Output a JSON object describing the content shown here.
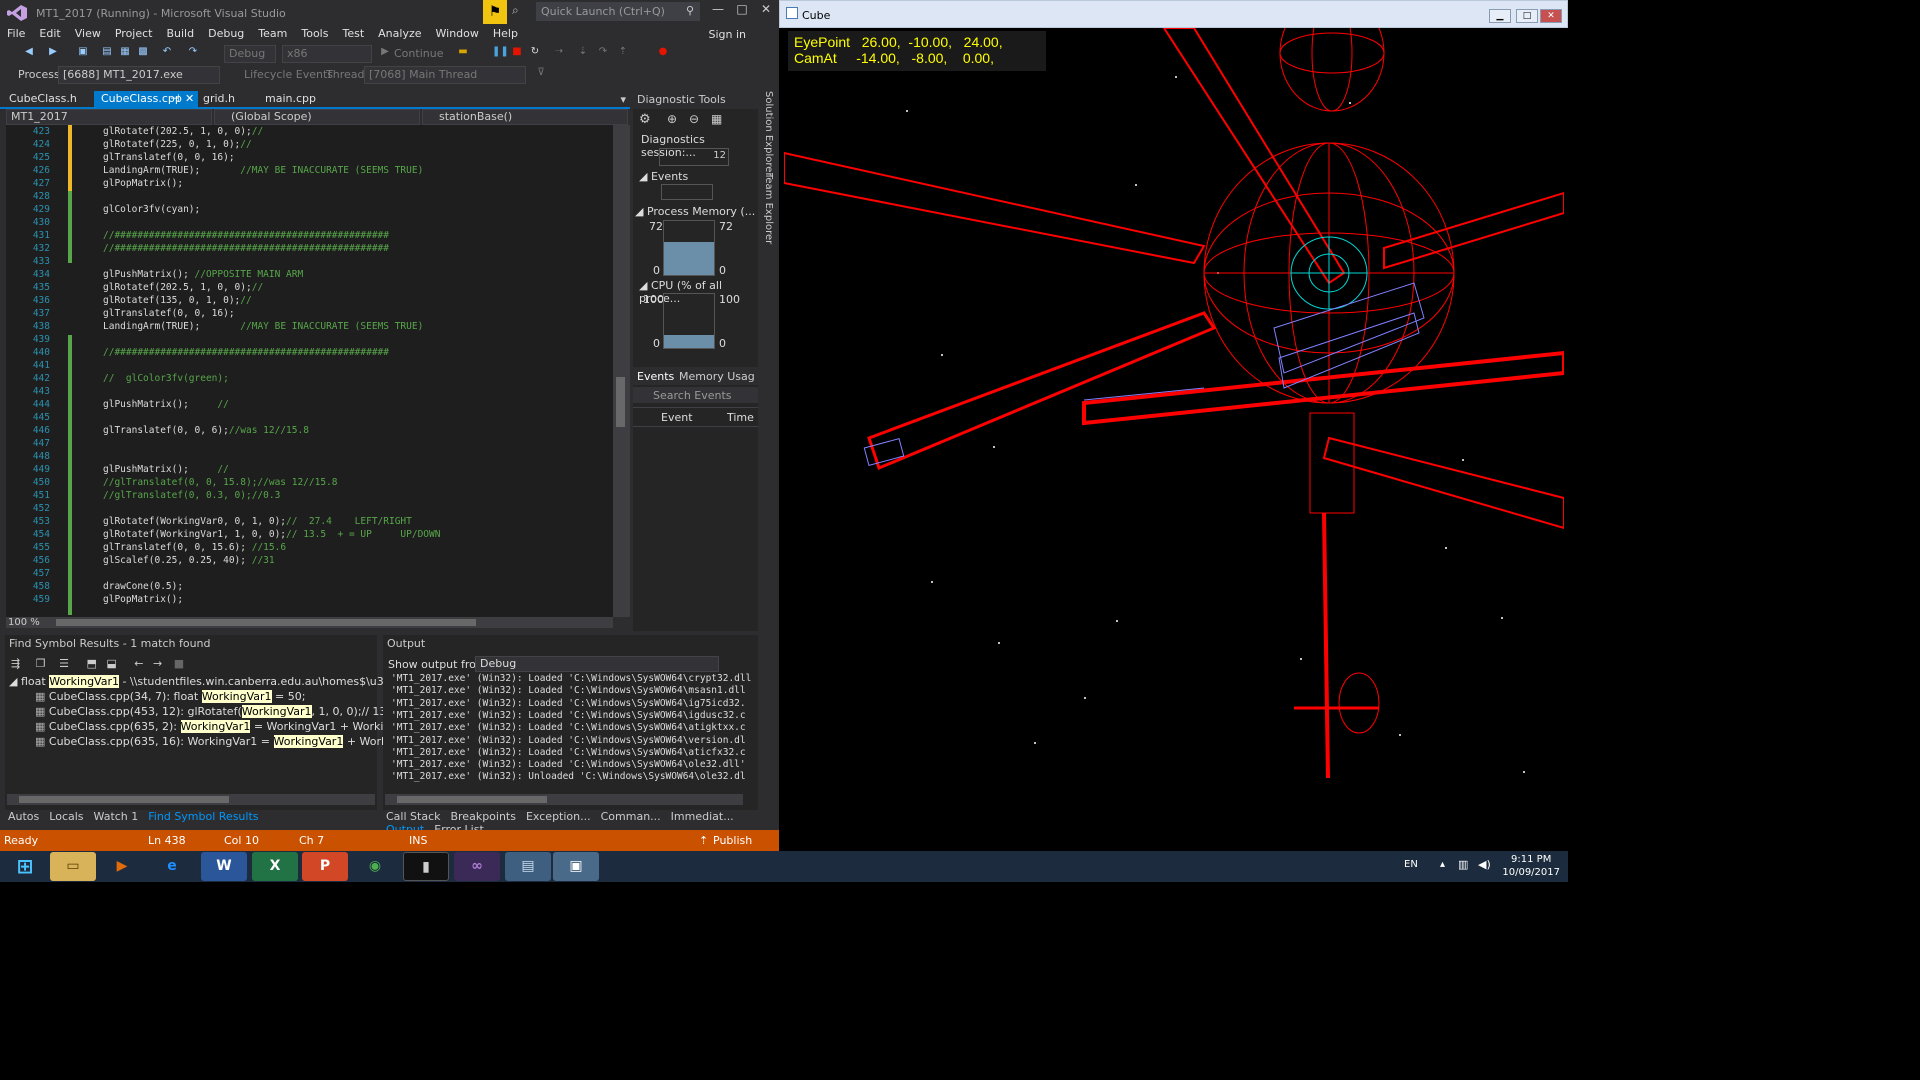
{
  "vs": {
    "title": "MT1_2017 (Running) - Microsoft Visual Studio",
    "quick_launch_placeholder": "Quick Launch (Ctrl+Q)",
    "menu": [
      "File",
      "Edit",
      "View",
      "Project",
      "Build",
      "Debug",
      "Team",
      "Tools",
      "Test",
      "Analyze",
      "Window",
      "Help"
    ],
    "sign_in": "Sign in",
    "config": "Debug",
    "platform": "x86",
    "continue_label": "Continue",
    "process_label": "Process:",
    "process_value": "[6688] MT1_2017.exe",
    "lifecycle_label": "Lifecycle Events",
    "thread_label": "Thread:",
    "thread_value": "[7068] Main Thread",
    "tabs": [
      "CubeClass.h",
      "CubeClass.cpp",
      "grid.h",
      "main.cpp"
    ],
    "active_tab": "CubeClass.cpp",
    "nav_project": "MT1_2017",
    "nav_scope": "(Global Scope)",
    "nav_member": "stationBase()",
    "zoom": "100 %",
    "code": [
      {
        "n": "423",
        "t": "glRotatef(202.5, 1, 0, 0);",
        "c": "//"
      },
      {
        "n": "424",
        "t": "glRotatef(225, 0, 1, 0);",
        "c": "//"
      },
      {
        "n": "425",
        "t": "glTranslatef(0, 0, 16);",
        "c": ""
      },
      {
        "n": "426",
        "t": "LandingArm(TRUE);       ",
        "c": "//MAY BE INACCURATE (SEEMS TRUE)"
      },
      {
        "n": "427",
        "t": "glPopMatrix();",
        "c": ""
      },
      {
        "n": "428",
        "t": "",
        "c": ""
      },
      {
        "n": "429",
        "t": "glColor3fv(cyan);",
        "c": ""
      },
      {
        "n": "430",
        "t": "",
        "c": ""
      },
      {
        "n": "431",
        "t": "",
        "c": "//################################################"
      },
      {
        "n": "432",
        "t": "",
        "c": "//################################################"
      },
      {
        "n": "433",
        "t": "",
        "c": ""
      },
      {
        "n": "434",
        "t": "glPushMatrix(); ",
        "c": "//OPPOSITE MAIN ARM"
      },
      {
        "n": "435",
        "t": "glRotatef(202.5, 1, 0, 0);",
        "c": "//"
      },
      {
        "n": "436",
        "t": "glRotatef(135, 0, 1, 0);",
        "c": "//"
      },
      {
        "n": "437",
        "t": "glTranslatef(0, 0, 16);",
        "c": ""
      },
      {
        "n": "438",
        "t": "LandingArm(TRUE);       ",
        "c": "//MAY BE INACCURATE (SEEMS TRUE)"
      },
      {
        "n": "439",
        "t": "",
        "c": ""
      },
      {
        "n": "440",
        "t": "",
        "c": "//################################################"
      },
      {
        "n": "441",
        "t": "",
        "c": ""
      },
      {
        "n": "442",
        "t": "",
        "c": "//  glColor3fv(green);"
      },
      {
        "n": "443",
        "t": "",
        "c": ""
      },
      {
        "n": "444",
        "t": "glPushMatrix();     ",
        "c": "//"
      },
      {
        "n": "445",
        "t": "",
        "c": ""
      },
      {
        "n": "446",
        "t": "glTranslatef(0, 0, 6);",
        "c": "//was 12//15.8"
      },
      {
        "n": "447",
        "t": "",
        "c": ""
      },
      {
        "n": "448",
        "t": "",
        "c": ""
      },
      {
        "n": "449",
        "t": "glPushMatrix();     ",
        "c": "//"
      },
      {
        "n": "450",
        "t": "",
        "c": "//glTranslatef(0, 0, 15.8);//was 12//15.8"
      },
      {
        "n": "451",
        "t": "",
        "c": "//glTranslatef(0, 0.3, 0);//0.3"
      },
      {
        "n": "452",
        "t": "",
        "c": ""
      },
      {
        "n": "453",
        "t": "glRotatef(WorkingVar0, 0, 1, 0);",
        "c": "//  27.4    LEFT/RIGHT"
      },
      {
        "n": "454",
        "t": "glRotatef(WorkingVar1, 1, 0, 0);",
        "c": "// 13.5  + = UP     UP/DOWN"
      },
      {
        "n": "455",
        "t": "glTranslatef(0, 0, 15.6); ",
        "c": "//15.6"
      },
      {
        "n": "456",
        "t": "glScalef(0.25, 0.25, 40); ",
        "c": "//31"
      },
      {
        "n": "457",
        "t": "",
        "c": ""
      },
      {
        "n": "458",
        "t": "drawCone(0.5);",
        "c": ""
      },
      {
        "n": "459",
        "t": "glPopMatrix();",
        "c": ""
      }
    ],
    "diag": {
      "title": "Diagnostic Tools",
      "session": "Diagnostics session:...",
      "session_val": "12",
      "events": "Events",
      "memory": "Process Memory (...",
      "mem_top": "72",
      "mem_bot": "0",
      "mem_fill": 0.62,
      "cpu": "CPU (% of all proce...",
      "cpu_top": "100",
      "cpu_bot": "0",
      "cpu_fill": 0.25,
      "tab_events": "Events",
      "tab_memory": "Memory Usag",
      "search": "Search Events",
      "col_event": "Event",
      "col_time": "Time"
    },
    "side_tabs": [
      "Solution Explorer",
      "Team Explorer"
    ],
    "find": {
      "title": "Find Symbol Results - 1 match found",
      "root_pre": "float ",
      "root_hl": "WorkingVar1",
      "root_post": " - \\\\studentfiles.win.canberra.edu.au\\homes$\\u3151658\\My",
      "rows": [
        {
          "pre": "CubeClass.cpp(34, 7): float ",
          "hl": "WorkingVar1",
          "post": " = 50;"
        },
        {
          "pre": "CubeClass.cpp(453, 12): glRotatef(",
          "hl": "WorkingVar1",
          "post": ", 1, 0, 0);// 13.5  + = UP  UP/"
        },
        {
          "pre": "CubeClass.cpp(635, 2): ",
          "hl": "WorkingVar1",
          "post": " = WorkingVar1 + WorkingVarPass1;"
        },
        {
          "pre": "CubeClass.cpp(635, 16): WorkingVar1 = ",
          "hl": "WorkingVar1",
          "post": " + WorkingVarPass1;"
        }
      ]
    },
    "output": {
      "title": "Output",
      "show_from": "Show output from:",
      "source": "Debug",
      "lines": [
        "'MT1_2017.exe' (Win32): Loaded 'C:\\Windows\\SysWOW64\\crypt32.dll",
        "'MT1_2017.exe' (Win32): Loaded 'C:\\Windows\\SysWOW64\\msasn1.dll",
        "'MT1_2017.exe' (Win32): Loaded 'C:\\Windows\\SysWOW64\\ig75icd32.",
        "'MT1_2017.exe' (Win32): Loaded 'C:\\Windows\\SysWOW64\\igdusc32.c",
        "'MT1_2017.exe' (Win32): Loaded 'C:\\Windows\\SysWOW64\\atigktxx.c",
        "'MT1_2017.exe' (Win32): Loaded 'C:\\Windows\\SysWOW64\\version.dl",
        "'MT1_2017.exe' (Win32): Loaded 'C:\\Windows\\SysWOW64\\aticfx32.c",
        "'MT1_2017.exe' (Win32): Loaded 'C:\\Windows\\SysWOW64\\ole32.dll'",
        "'MT1_2017.exe' (Win32): Unloaded 'C:\\Windows\\SysWOW64\\ole32.dl"
      ]
    },
    "left_tabs": [
      "Autos",
      "Locals",
      "Watch 1",
      "Find Symbol Results"
    ],
    "right_tabs": [
      "Call Stack",
      "Breakpoints",
      "Exception...",
      "Comman...",
      "Immediat...",
      "Output",
      "Error List"
    ],
    "status": {
      "ready": "Ready",
      "ln": "Ln 438",
      "col": "Col 10",
      "ch": "Ch 7",
      "ins": "INS",
      "publish": "Publish"
    }
  },
  "cube": {
    "title": "Cube",
    "hud_line1": "EyePoint   26.00,  -10.00,   24.00,",
    "hud_line2": "CamAt     -14.00,   -8.00,    0.00,"
  },
  "taskbar": {
    "lang": "EN",
    "time": "9:11 PM",
    "date": "10/09/2017"
  }
}
